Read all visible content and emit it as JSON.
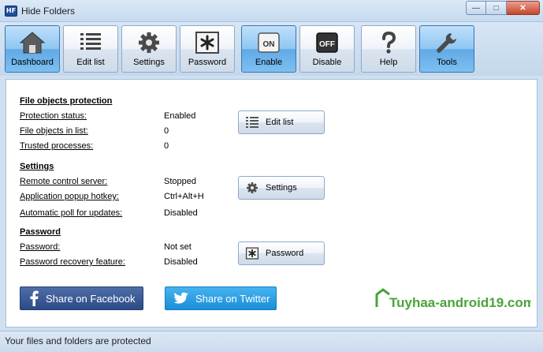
{
  "window": {
    "title": "Hide Folders",
    "app_icon_text": "HF",
    "controls": {
      "minimize": "—",
      "maximize": "□",
      "close": "✕"
    }
  },
  "toolbar": {
    "items": [
      {
        "id": "dashboard",
        "label": "Dashboard",
        "icon": "home-icon",
        "active": true
      },
      {
        "id": "edit-list",
        "label": "Edit list",
        "icon": "list-icon",
        "active": false
      },
      {
        "id": "settings",
        "label": "Settings",
        "icon": "gear-icon",
        "active": false
      },
      {
        "id": "password",
        "label": "Password",
        "icon": "asterisk-icon",
        "active": false
      },
      {
        "id": "enable",
        "label": "Enable",
        "icon": "on-switch-icon",
        "icon_text": "ON",
        "active": true
      },
      {
        "id": "disable",
        "label": "Disable",
        "icon": "off-switch-icon",
        "icon_text": "OFF",
        "active": false
      },
      {
        "id": "help",
        "label": "Help",
        "icon": "question-icon",
        "active": false
      },
      {
        "id": "tools",
        "label": "Tools",
        "icon": "wrench-icon",
        "active": true
      }
    ]
  },
  "sections": {
    "file_objects": {
      "title": "File objects protection",
      "rows": [
        {
          "label": "Protection status:",
          "value": "Enabled"
        },
        {
          "label": "File objects in list:",
          "value": "0"
        },
        {
          "label": "Trusted processes:",
          "value": "0"
        }
      ],
      "button": {
        "label": "Edit list",
        "icon": "list-icon"
      }
    },
    "settings": {
      "title": "Settings",
      "rows": [
        {
          "label": "Remote control server:",
          "value": "Stopped"
        },
        {
          "label": "Application popup hotkey:",
          "value": "Ctrl+Alt+H"
        },
        {
          "label": "Automatic poll for updates:",
          "value": "Disabled"
        }
      ],
      "button": {
        "label": "Settings",
        "icon": "gear-icon"
      }
    },
    "password": {
      "title": "Password",
      "rows": [
        {
          "label": "Password:",
          "value": "Not set"
        },
        {
          "label": "Password recovery feature:",
          "value": "Disabled"
        }
      ],
      "button": {
        "label": "Password",
        "icon": "asterisk-icon"
      }
    }
  },
  "share": {
    "facebook": "Share on Facebook",
    "twitter": "Share on Twitter"
  },
  "watermark": {
    "text": "Tuyhaa-android19.com"
  },
  "status": {
    "text": "Your files and folders are protected"
  },
  "colors": {
    "active": "#62a9e6",
    "facebook": "#2c4a86",
    "twitter": "#1a8ed8",
    "watermark": "#4aa33a"
  }
}
